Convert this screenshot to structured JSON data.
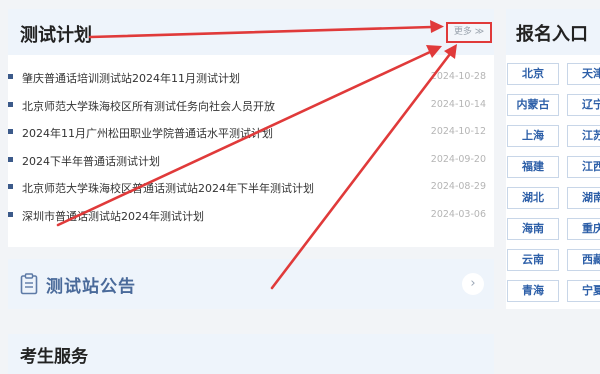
{
  "plan": {
    "title": "测试计划",
    "more_label": "更多 ≫",
    "items": [
      {
        "text": "肇庆普通话培训测试站2024年11月测试计划",
        "date": "2024-10-28"
      },
      {
        "text": "北京师范大学珠海校区所有测试任务向社会人员开放",
        "date": "2024-10-14"
      },
      {
        "text": "2024年11月广州松田职业学院普通话水平测试计划",
        "date": "2024-10-12"
      },
      {
        "text": "2024下半年普通话测试计划",
        "date": "2024-09-20"
      },
      {
        "text": "北京师范大学珠海校区普通话测试站2024年下半年测试计划",
        "date": "2024-08-29"
      },
      {
        "text": "深圳市普通话测试站2024年测试计划",
        "date": "2024-03-06"
      }
    ]
  },
  "notice": {
    "title": "测试站公告",
    "icon": "clipboard-icon",
    "arrow": "›"
  },
  "service": {
    "title": "考生服务"
  },
  "registration": {
    "title": "报名入口",
    "regions": [
      "北京",
      "天津",
      "内蒙古",
      "辽宁",
      "上海",
      "江苏",
      "福建",
      "江西",
      "湖北",
      "湖南",
      "海南",
      "重庆",
      "云南",
      "西藏",
      "青海",
      "宁夏"
    ]
  },
  "colors": {
    "annotation_red": "#e03a3a",
    "region_text": "#2d5fa8",
    "header_bg": "#eef4fb"
  }
}
